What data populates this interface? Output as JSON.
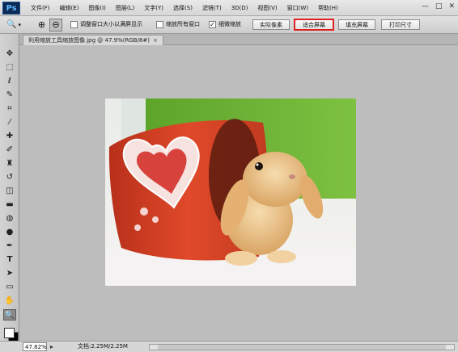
{
  "app": {
    "logo": "Ps"
  },
  "menu": [
    "文件(F)",
    "编辑(E)",
    "图像(I)",
    "图层(L)",
    "文字(Y)",
    "选择(S)",
    "滤镜(T)",
    "3D(D)",
    "视图(V)",
    "窗口(W)",
    "帮助(H)"
  ],
  "window_controls": {
    "minimize": "—",
    "maximize": "□",
    "close": "✕"
  },
  "options": {
    "tool_glyph": "🔍",
    "dropdown_glyph": "▾",
    "zoom_in_glyph": "⊕",
    "zoom_out_glyph": "⊖",
    "resize_windows": {
      "label": "调整窗口大小以满屏显示",
      "checked": false
    },
    "zoom_all_windows": {
      "label": "缩放所有窗口",
      "checked": false
    },
    "scrubby_zoom": {
      "label": "细微缩放",
      "checked": true
    },
    "buttons": {
      "actual_pixels": "实际像素",
      "fit_screen": "适合屏幕",
      "fill_screen": "填充屏幕",
      "print_size": "打印尺寸"
    },
    "check_glyph": "✓"
  },
  "document": {
    "tab_title": "利用缩放工具缩放图像.jpg @ 47.9%(RGB/8#)",
    "close_glyph": "×"
  },
  "tools": [
    {
      "name": "move-tool-icon",
      "glyph": "✥"
    },
    {
      "name": "marquee-tool-icon",
      "glyph": "⬚"
    },
    {
      "name": "lasso-tool-icon",
      "glyph": "ℓ"
    },
    {
      "name": "quick-select-tool-icon",
      "glyph": "✎"
    },
    {
      "name": "crop-tool-icon",
      "glyph": "⌗"
    },
    {
      "name": "eyedropper-tool-icon",
      "glyph": "⁄"
    },
    {
      "name": "healing-brush-tool-icon",
      "glyph": "✚"
    },
    {
      "name": "brush-tool-icon",
      "glyph": "✐"
    },
    {
      "name": "clone-stamp-tool-icon",
      "glyph": "♜"
    },
    {
      "name": "history-brush-tool-icon",
      "glyph": "↺"
    },
    {
      "name": "eraser-tool-icon",
      "glyph": "◫"
    },
    {
      "name": "gradient-tool-icon",
      "glyph": "▬"
    },
    {
      "name": "blur-tool-icon",
      "glyph": "◍"
    },
    {
      "name": "dodge-tool-icon",
      "glyph": "●"
    },
    {
      "name": "pen-tool-icon",
      "glyph": "✒"
    },
    {
      "name": "type-tool-icon",
      "glyph": "T"
    },
    {
      "name": "path-select-tool-icon",
      "glyph": "➤"
    },
    {
      "name": "shape-tool-icon",
      "glyph": "▭"
    },
    {
      "name": "hand-tool-icon",
      "glyph": "✋"
    },
    {
      "name": "zoom-tool-icon",
      "glyph": "🔍"
    }
  ],
  "status": {
    "zoom": "47.82%",
    "icon_glyph": "▸",
    "doc_info": "文档:2.25M/2.25M"
  }
}
